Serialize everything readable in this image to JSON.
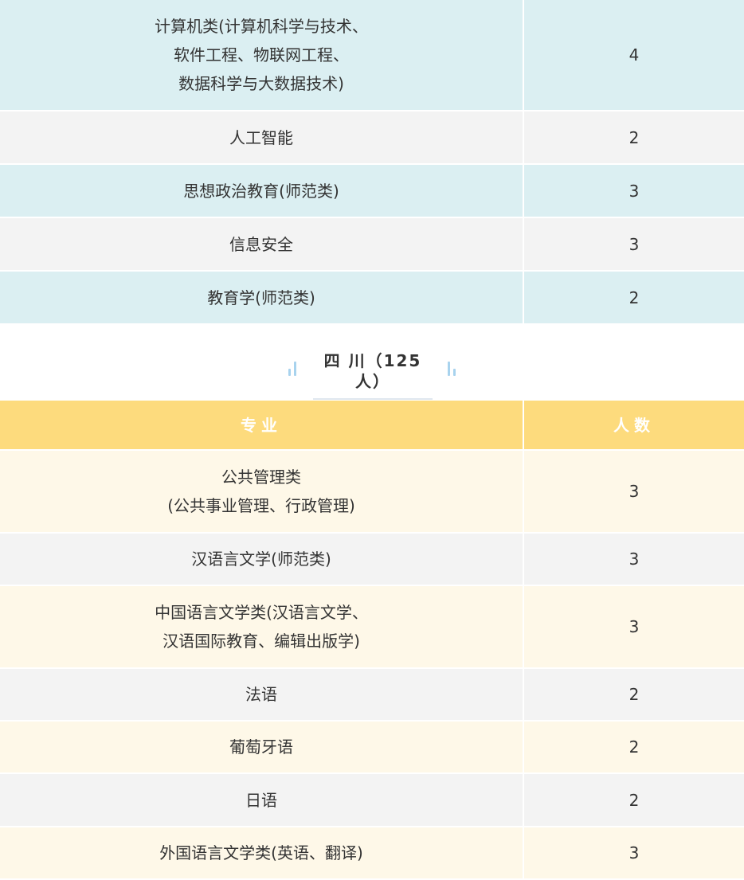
{
  "table1": {
    "rows": [
      {
        "major": "计算机类(计算机科学与技术、\n软件工程、物联网工程、\n数据科学与大数据技术)",
        "count": "4",
        "style": "blue",
        "h": 139
      },
      {
        "major": "人工智能",
        "count": "2",
        "style": "grey",
        "h": 67
      },
      {
        "major": "思想政治教育(师范类)",
        "count": "3",
        "style": "blue",
        "h": 67
      },
      {
        "major": "信息安全",
        "count": "3",
        "style": "grey",
        "h": 67
      },
      {
        "major": "教育学(师范类)",
        "count": "2",
        "style": "blue",
        "h": 67
      }
    ]
  },
  "section": {
    "title": "四 川（125人）"
  },
  "table2": {
    "header": {
      "major": "专业",
      "count": "人数"
    },
    "rows": [
      {
        "major": "公共管理类\n(公共事业管理、行政管理)",
        "count": "3",
        "style": "cream",
        "h": 104
      },
      {
        "major": "汉语言文学(师范类)",
        "count": "3",
        "style": "grey",
        "h": 66
      },
      {
        "major": "中国语言文学类(汉语言文学、\n汉语国际教育、编辑出版学)",
        "count": "3",
        "style": "cream",
        "h": 104
      },
      {
        "major": "法语",
        "count": "2",
        "style": "grey",
        "h": 66
      },
      {
        "major": "葡萄牙语",
        "count": "2",
        "style": "cream",
        "h": 66
      },
      {
        "major": "日语",
        "count": "2",
        "style": "grey",
        "h": 67
      },
      {
        "major": "外国语言文学类(英语、翻译)",
        "count": "3",
        "style": "cream",
        "h": 66
      }
    ]
  }
}
